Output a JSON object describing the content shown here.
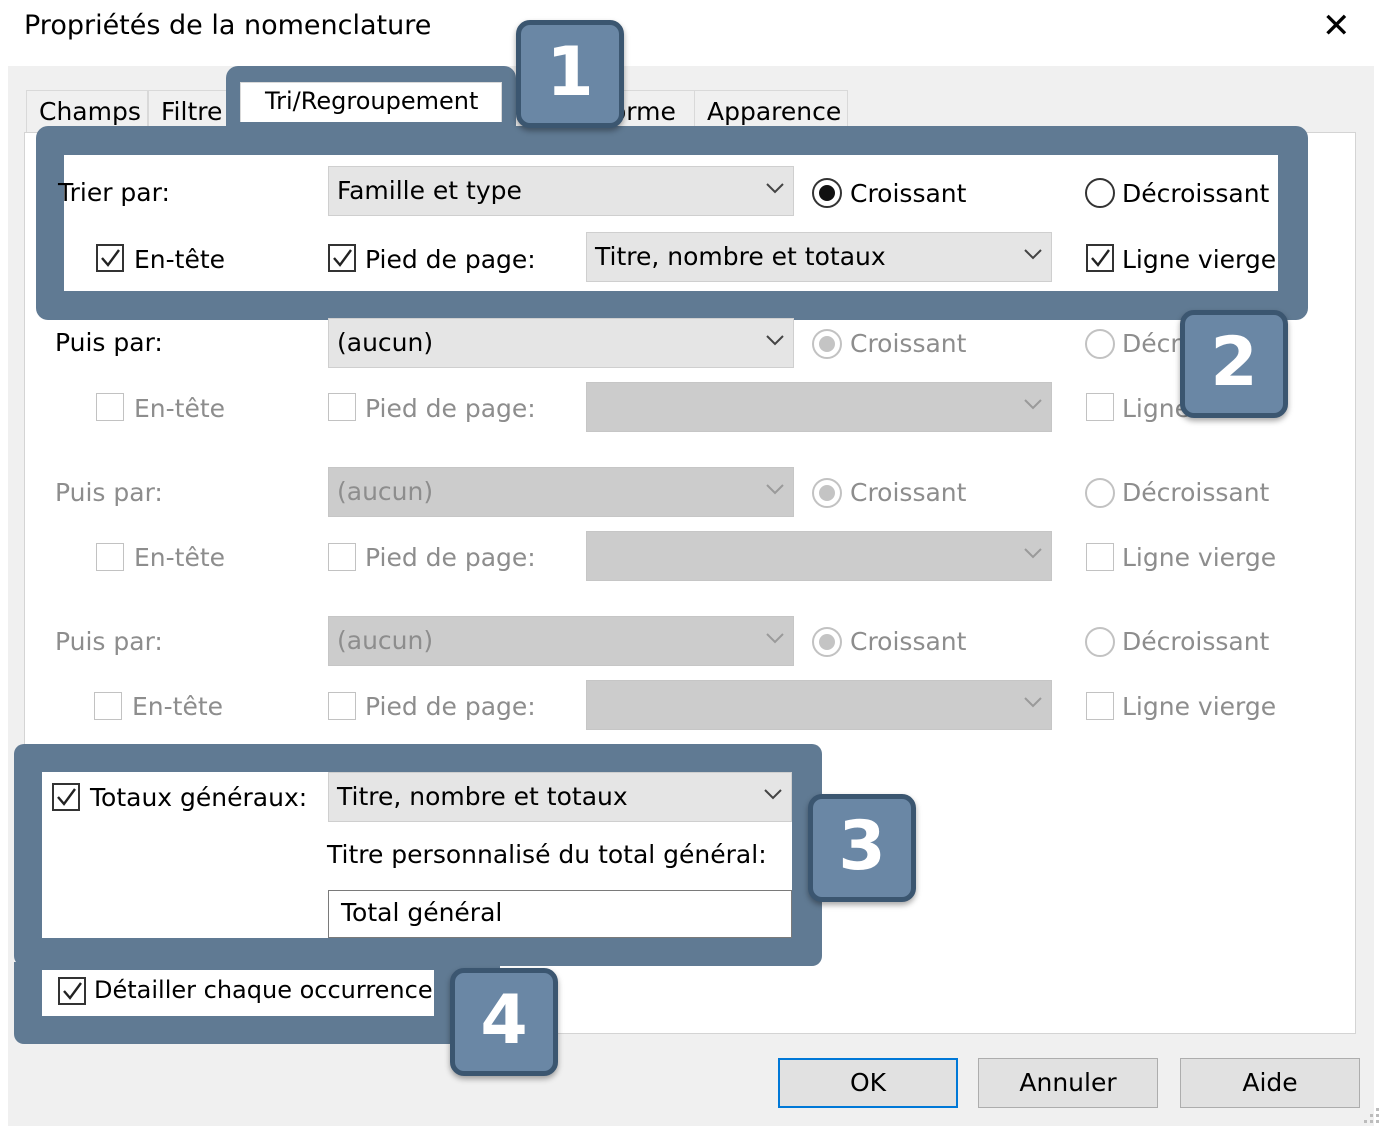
{
  "window": {
    "title": "Propriétés de la nomenclature",
    "close": "✕"
  },
  "tabs": [
    "Champs",
    "Filtre",
    "Tri/Regroupement",
    "Forme",
    "Apparence"
  ],
  "tab_visible": {
    "forme_partial": "orme"
  },
  "row1": {
    "label": "Trier par:",
    "value": "Famille et type",
    "asc": "Croissant",
    "desc": "Décroissant",
    "header": "En-tête",
    "footer": "Pied de page:",
    "footer_value": "Titre, nombre et totaux",
    "blank": "Ligne vierge"
  },
  "row2": {
    "label": "Puis par:",
    "value": "(aucun)",
    "asc": "Croissant",
    "desc_partial": "Décr",
    "header": "En-tête",
    "footer": "Pied de page:",
    "blank_partial": "Ligne"
  },
  "row3": {
    "label": "Puis par:",
    "value": "(aucun)",
    "asc": "Croissant",
    "desc": "Décroissant",
    "header": "En-tête",
    "footer": "Pied de page:",
    "blank": "Ligne vierge"
  },
  "row4": {
    "label": "Puis par:",
    "value": "(aucun)",
    "asc": "Croissant",
    "desc": "Décroissant",
    "header": "En-tête",
    "footer": "Pied de page:",
    "blank": "Ligne vierge"
  },
  "totals": {
    "label": "Totaux généraux:",
    "value": "Titre, nombre et totaux",
    "custom_title_label": "Titre personnalisé du total général:",
    "custom_title_value": "Total général"
  },
  "detail": {
    "label": "Détailler chaque occurrence"
  },
  "buttons": {
    "ok": "OK",
    "cancel": "Annuler",
    "help": "Aide"
  },
  "callouts": [
    "1",
    "2",
    "3",
    "4"
  ],
  "colors": {
    "callout": "#607a93",
    "badge": "#6a87a5",
    "default_button_border": "#0078d7"
  }
}
